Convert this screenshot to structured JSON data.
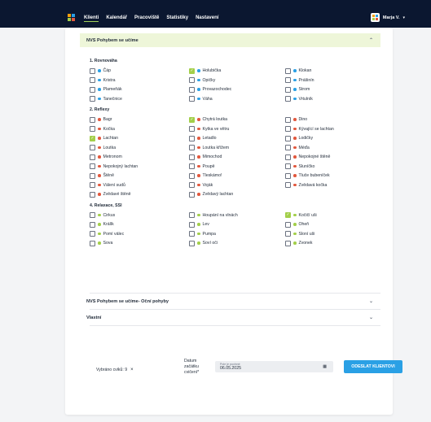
{
  "nav": {
    "items": [
      "Klienti",
      "Kalendář",
      "Pracoviště",
      "Statistiky",
      "Nastavení"
    ],
    "active": "Klienti"
  },
  "user": {
    "name": "Marja V.",
    "caret": "▾"
  },
  "sections": {
    "open": {
      "title": "NVS Pohybem se učíme",
      "chevron": "⌃"
    },
    "eye": {
      "title": "NVS Pohybem se učíme- Oční pohyby",
      "chevron": "⌄"
    },
    "own": {
      "title": "Vlastní",
      "chevron": "⌄"
    }
  },
  "groups": [
    {
      "title": "1. Rovnováha",
      "dot_color": "#2aa0e5",
      "items": [
        {
          "label": "Čáp",
          "checked": false
        },
        {
          "label": "Holubička",
          "checked": true
        },
        {
          "label": "Klokan",
          "checked": false
        },
        {
          "label": "Kristra",
          "checked": false
        },
        {
          "label": "Opičky",
          "checked": false
        },
        {
          "label": "Prášinín",
          "checked": false
        },
        {
          "label": "Plameňák",
          "checked": false
        },
        {
          "label": "Provazochodec",
          "checked": false
        },
        {
          "label": "Strom",
          "checked": false
        },
        {
          "label": "Tanečnice",
          "checked": false
        },
        {
          "label": "Váha",
          "checked": false
        },
        {
          "label": "Vrtulník",
          "checked": false
        }
      ]
    },
    {
      "title": "2. Reflexy",
      "dot_color": "#e2583e",
      "items": [
        {
          "label": "Bagr",
          "checked": false
        },
        {
          "label": "Chytrá loutka",
          "checked": true
        },
        {
          "label": "Dino",
          "checked": false
        },
        {
          "label": "Kočka",
          "checked": false
        },
        {
          "label": "Kytka ve větru",
          "checked": false
        },
        {
          "label": "Kývající se lachtan",
          "checked": false
        },
        {
          "label": "Lachtan",
          "checked": true
        },
        {
          "label": "Letadlo",
          "checked": false
        },
        {
          "label": "Lodičky",
          "checked": false
        },
        {
          "label": "Loutka",
          "checked": false
        },
        {
          "label": "Loutka křížem",
          "checked": false
        },
        {
          "label": "Méďa",
          "checked": false
        },
        {
          "label": "Metronom",
          "checked": false
        },
        {
          "label": "Mimochod",
          "checked": false
        },
        {
          "label": "Nepokojné štěně",
          "checked": false
        },
        {
          "label": "Nepokojný lachtan",
          "checked": false
        },
        {
          "label": "Poupě",
          "checked": false
        },
        {
          "label": "Sluníčko",
          "checked": false
        },
        {
          "label": "Štěně",
          "checked": false
        },
        {
          "label": "Tleskámo!",
          "checked": false
        },
        {
          "label": "Tluče bubeníček",
          "checked": false
        },
        {
          "label": "Válení sudů",
          "checked": false
        },
        {
          "label": "Voják",
          "checked": false
        },
        {
          "label": "Zvědavá kočka",
          "checked": false
        },
        {
          "label": "Zvědavé štěně",
          "checked": false
        },
        {
          "label": "Zvědavý lachtan",
          "checked": false
        }
      ]
    },
    {
      "title": "4. Relaxace, SSI",
      "dot_color": "#a3cf4a",
      "items": [
        {
          "label": "Cirkus",
          "checked": false
        },
        {
          "label": "Houpání na vlnách",
          "checked": false
        },
        {
          "label": "Kočičí uši",
          "checked": true
        },
        {
          "label": "Králík",
          "checked": false
        },
        {
          "label": "Lev",
          "checked": false
        },
        {
          "label": "Oheň",
          "checked": false
        },
        {
          "label": "Pomí válec",
          "checked": false
        },
        {
          "label": "Pumpa",
          "checked": false
        },
        {
          "label": "Sloní uši",
          "checked": false
        },
        {
          "label": "Sova",
          "checked": false
        },
        {
          "label": "Soví oči",
          "checked": false
        },
        {
          "label": "Zvonek",
          "checked": false
        }
      ]
    }
  ],
  "footer": {
    "selected_label": "Vybráno cviků: 9",
    "clear": "×",
    "date_label": "Datum začátku cvičení*",
    "date_placeholder": "Pole je povinné",
    "date_value": "06.05.2025",
    "calendar_icon": "▦",
    "send_button": "ODESLAT KLIENTOVI"
  },
  "colors": {
    "topbar": "#0b1730",
    "accent_green": "#a3cf4a",
    "accent_blue": "#2aa0e5",
    "accent_red": "#e2583e"
  }
}
